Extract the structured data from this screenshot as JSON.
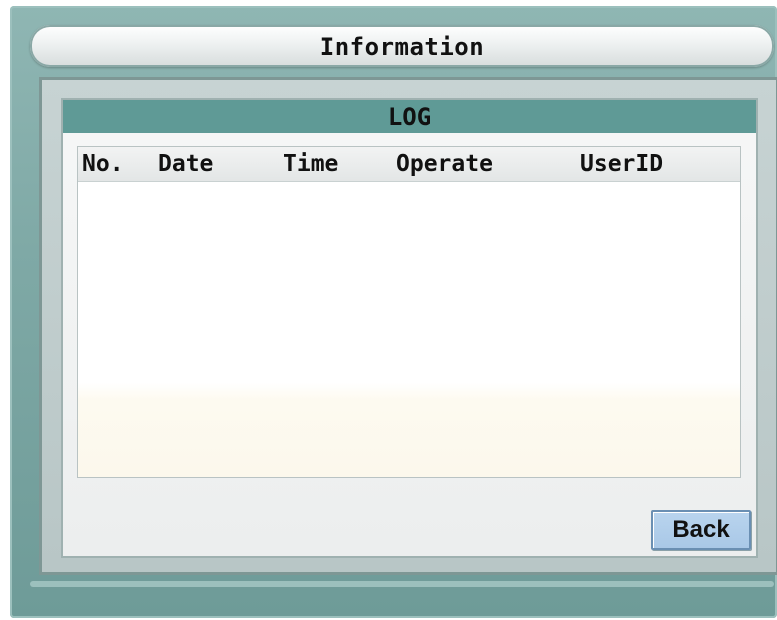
{
  "window": {
    "title": "Information"
  },
  "panel": {
    "title": "LOG"
  },
  "log_table": {
    "columns": [
      "No.",
      "Date",
      "Time",
      "Operate",
      "UserID"
    ],
    "rows": []
  },
  "buttons": {
    "back_label": "Back"
  },
  "colors": {
    "frame": "#7fa9a6",
    "header_bar": "#5f9a96",
    "button": "#a9c8e7"
  }
}
